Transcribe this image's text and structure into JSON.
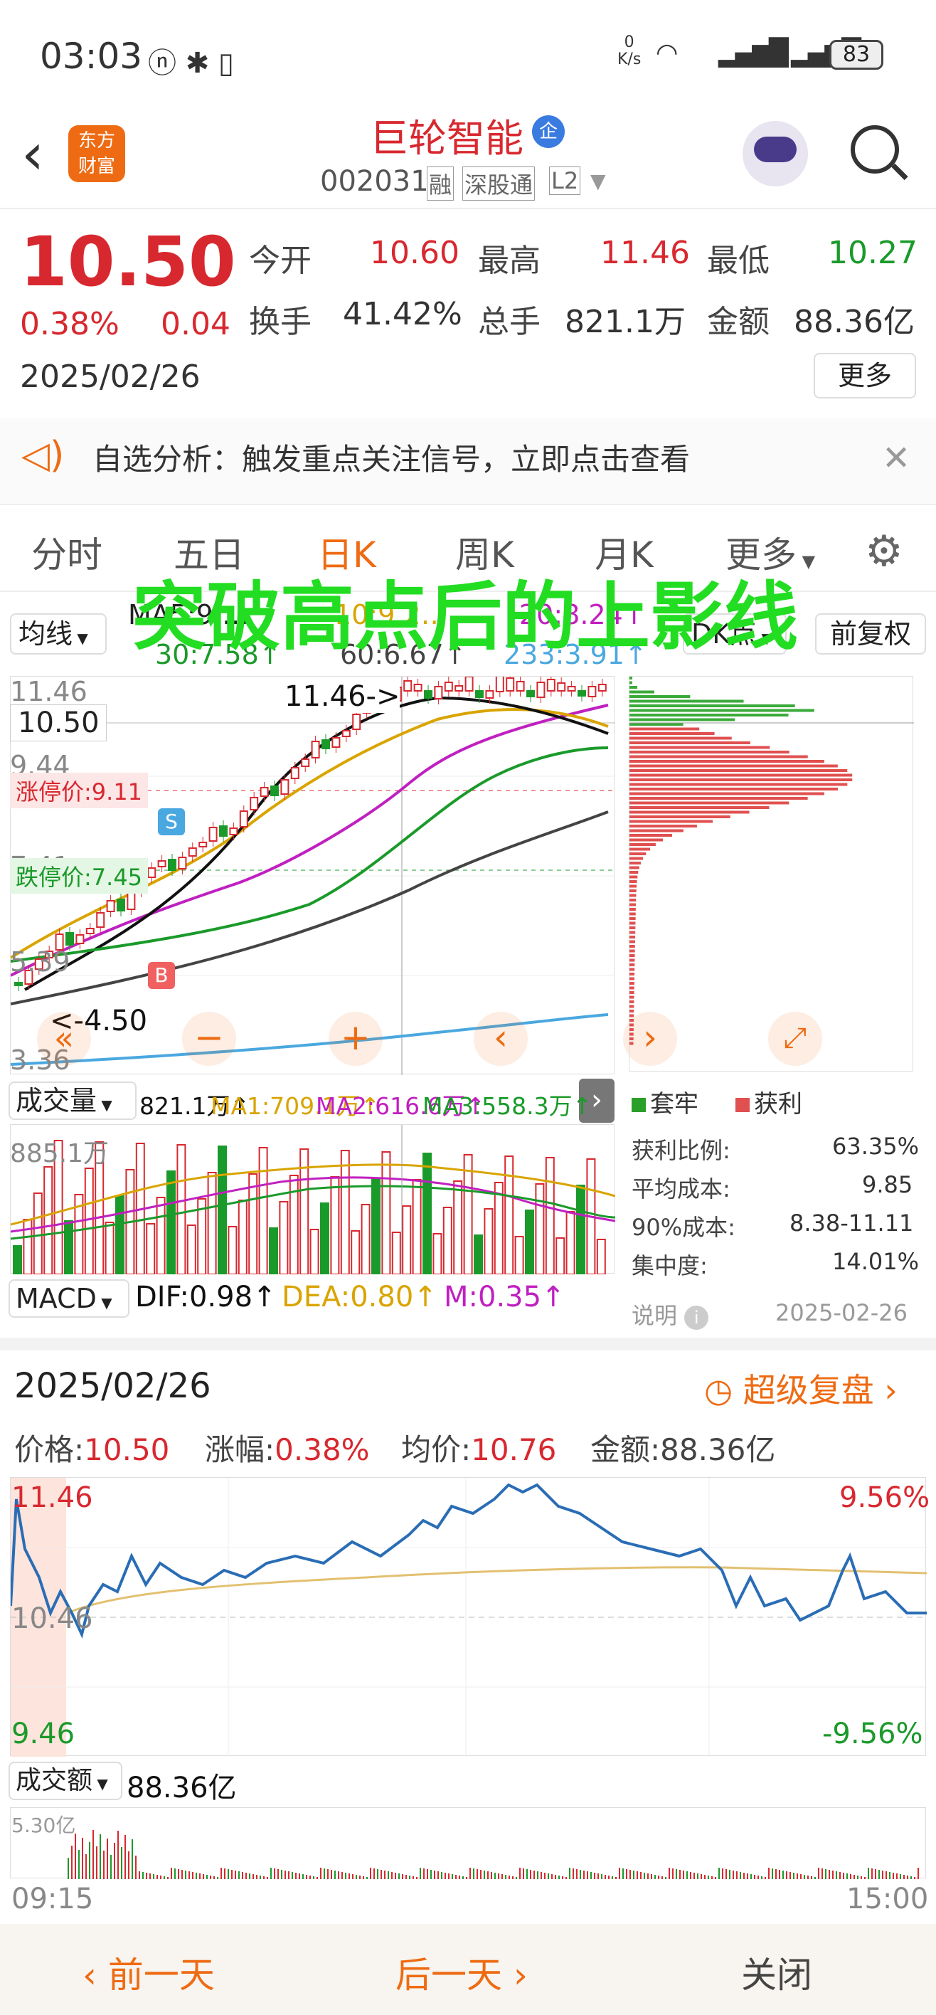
{
  "status_bar": {
    "time": "03:03",
    "net_speed_top": "0",
    "net_speed_unit": "K/s",
    "network": "6",
    "battery": "83"
  },
  "header": {
    "title": "巨轮智能",
    "badge": "企",
    "code": "002031",
    "tags": [
      "融",
      "深股通",
      "L2"
    ],
    "logo_line1": "东方",
    "logo_line2": "财富"
  },
  "quote": {
    "price": "10.50",
    "change_pct": "0.38%",
    "change": "0.04",
    "date": "2025/02/26",
    "open_label": "今开",
    "open": "10.60",
    "high_label": "最高",
    "high": "11.46",
    "low_label": "最低",
    "low": "10.27",
    "turnover_label": "换手",
    "turnover": "41.42%",
    "volume_label": "总手",
    "volume": "821.1万",
    "amount_label": "金额",
    "amount": "88.36亿",
    "more": "更多"
  },
  "notice": {
    "text": "自选分析：触发重点关注信号，立即点击查看"
  },
  "tabs": [
    "分时",
    "五日",
    "日K",
    "周K",
    "月K",
    "更多"
  ],
  "overlay_title": "突破高点后的上影线",
  "kline": {
    "indicator": "均线",
    "ma_items": [
      "MA5:9.…",
      "10:9.2…",
      "20:8.24↑",
      "30:7.58↑",
      "60:6.67↑",
      "233:3.91↑"
    ],
    "dk": "DK点",
    "adjust": "前复权",
    "y_top": "11.46",
    "y_2": "9.44",
    "y_3": "7.41",
    "y_4": "5.39",
    "y_bottom": "3.36",
    "current": "10.50",
    "high_note": "11.46->",
    "low_note": "<-4.50",
    "limit_up": "涨停价:9.11",
    "limit_down": "跌停价:7.45",
    "sell": "S",
    "buy": "B"
  },
  "volume": {
    "label": "成交量",
    "value": "821.1万↑",
    "ma1": "MA1:709.1万↑",
    "ma2": "MA2:616.6万↑",
    "ma3": "MA3:558.3万↑",
    "axis": "885.1万"
  },
  "macd": {
    "label": "MACD",
    "dif": "DIF:0.98↑",
    "dea": "DEA:0.80↑",
    "m": "M:0.35↑"
  },
  "chips": {
    "legend_trap": "套牢",
    "legend_profit": "获利",
    "profit_ratio_label": "获利比例:",
    "profit_ratio": "63.35%",
    "avg_cost_label": "平均成本:",
    "avg_cost": "9.85",
    "cost90_label": "90%成本:",
    "cost90": "8.38-11.11",
    "concentration_label": "集中度:",
    "concentration": "14.01%",
    "note": "说明",
    "date": "2025-02-26"
  },
  "intraday": {
    "date": "2025/02/26",
    "replay": "超级复盘",
    "price_label": "价格:",
    "price": "10.50",
    "chg_label": "涨幅:",
    "chg": "0.38%",
    "avg_label": "均价:",
    "avg": "10.76",
    "amt_label": "金额:",
    "amt": "88.36亿",
    "y_top": "11.46",
    "y_mid": "10.46",
    "y_bottom": "9.46",
    "pct_top": "9.56%",
    "pct_bottom": "-9.56%",
    "amount_label": "成交额",
    "amount_value": "88.36亿",
    "amount_axis": "5.30亿",
    "t_start": "09:15",
    "t_end": "15:00"
  },
  "footer": {
    "prev": "前一天",
    "next": "后一天",
    "close": "关闭"
  },
  "colors": {
    "up": "#d8282f",
    "down": "#1a9a2a",
    "accent": "#ee6b13",
    "overlay": "#22dd22"
  }
}
